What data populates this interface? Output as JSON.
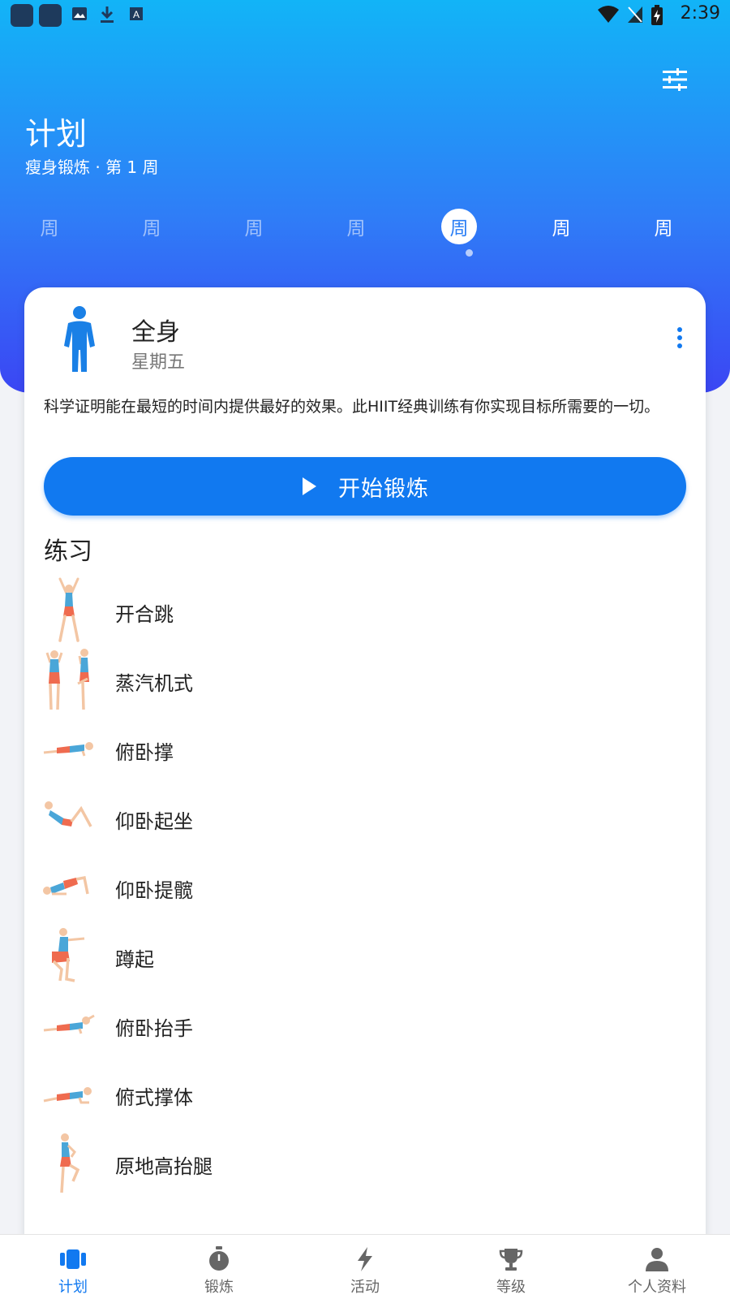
{
  "status_bar": {
    "time": "2:39"
  },
  "header": {
    "title": "计划",
    "subtitle": "瘦身锻炼 · 第 1 周",
    "days": [
      {
        "label": "周",
        "state": "past"
      },
      {
        "label": "周",
        "state": "past"
      },
      {
        "label": "周",
        "state": "past"
      },
      {
        "label": "周",
        "state": "past"
      },
      {
        "label": "周",
        "state": "selected"
      },
      {
        "label": "周",
        "state": "upcoming"
      },
      {
        "label": "周",
        "state": "upcoming"
      }
    ]
  },
  "workout": {
    "title": "全身",
    "day": "星期五",
    "description": "科学证明能在最短的时间内提供最好的效果。此HIIT经典训练有你实现目标所需要的一切。",
    "start_label": "开始锻炼"
  },
  "exercises_title": "练习",
  "exercises": [
    {
      "name": "开合跳"
    },
    {
      "name": "蒸汽机式"
    },
    {
      "name": "俯卧撑"
    },
    {
      "name": "仰卧起坐"
    },
    {
      "name": "仰卧提髋"
    },
    {
      "name": "蹲起"
    },
    {
      "name": "俯卧抬手"
    },
    {
      "name": "俯式撑体"
    },
    {
      "name": "原地高抬腿"
    }
  ],
  "nav": [
    {
      "label": "计划",
      "icon": "plan-icon",
      "active": true
    },
    {
      "label": "锻炼",
      "icon": "stopwatch-icon",
      "active": false
    },
    {
      "label": "活动",
      "icon": "lightning-icon",
      "active": false
    },
    {
      "label": "等级",
      "icon": "trophy-icon",
      "active": false
    },
    {
      "label": "个人资料",
      "icon": "person-icon",
      "active": false
    }
  ],
  "colors": {
    "accent": "#1179f0",
    "header_top": "#12b4f7",
    "header_bottom": "#3b46f4",
    "figure_blue": "#1a80e6",
    "skin": "#f3c6a4",
    "shorts": "#ef6b4f",
    "top": "#4aa6d8"
  }
}
